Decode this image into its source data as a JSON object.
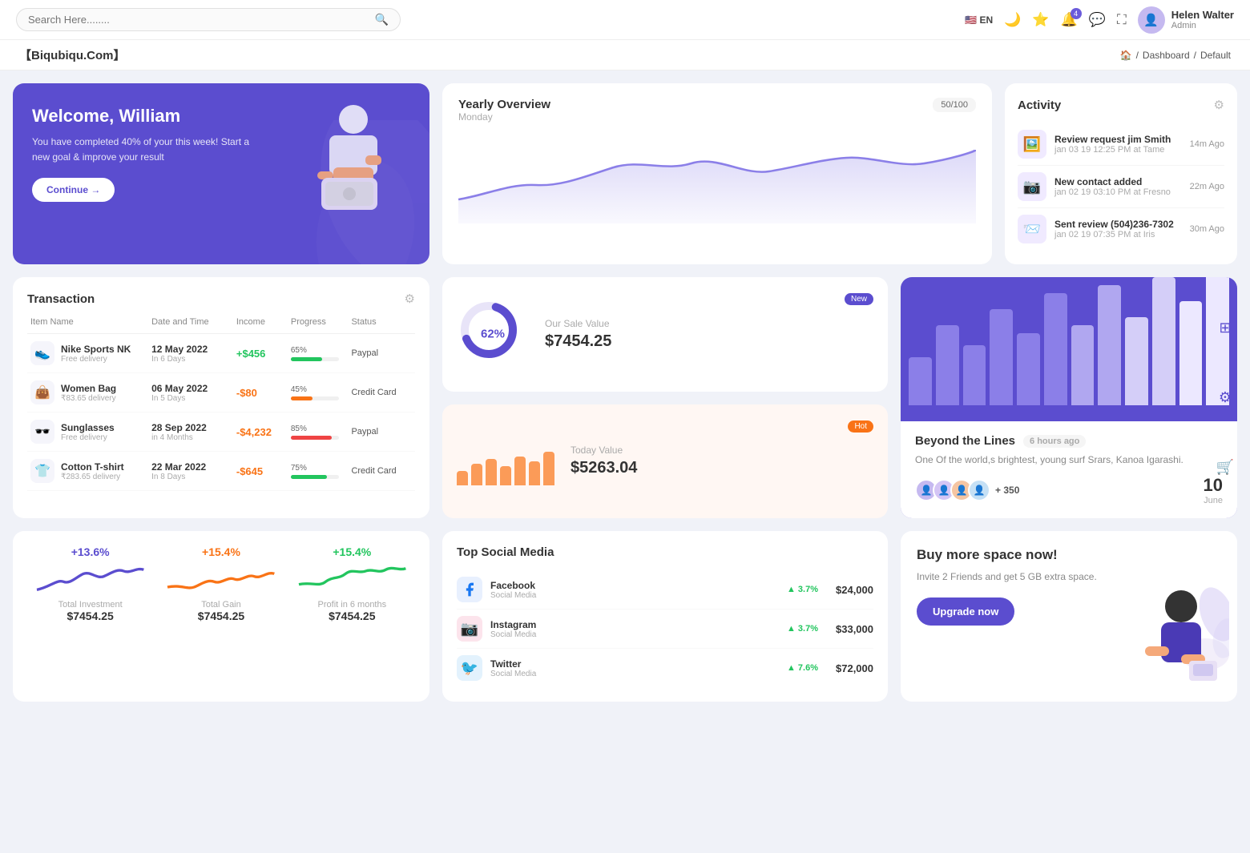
{
  "topnav": {
    "search_placeholder": "Search Here........",
    "lang": "EN",
    "notification_count": "4",
    "user_name": "Helen Walter",
    "user_role": "Admin"
  },
  "breadcrumb": {
    "brand": "【Biqubiqu.Com】",
    "home": "⌂",
    "path1": "Dashboard",
    "path2": "Default"
  },
  "welcome": {
    "title": "Welcome, William",
    "desc": "You have completed 40% of your this week! Start a new goal & improve your result",
    "btn": "Continue →"
  },
  "yearly": {
    "title": "Yearly Overview",
    "day": "Monday",
    "badge": "50/100"
  },
  "activity": {
    "title": "Activity",
    "items": [
      {
        "title": "Review request jim Smith",
        "sub": "jan 03 19 12:25 PM at Tame",
        "time": "14m Ago"
      },
      {
        "title": "New contact added",
        "sub": "jan 02 19 03:10 PM at Fresno",
        "time": "22m Ago"
      },
      {
        "title": "Sent review (504)236-7302",
        "sub": "jan 02 19 07:35 PM at Iris",
        "time": "30m Ago"
      }
    ]
  },
  "transaction": {
    "title": "Transaction",
    "columns": [
      "Item Name",
      "Date and Time",
      "Income",
      "Progress",
      "Status"
    ],
    "rows": [
      {
        "icon": "👟",
        "name": "Nike Sports NK",
        "sub": "Free delivery",
        "date": "12 May 2022",
        "days": "In 6 Days",
        "income": "+$456",
        "income_type": "pos",
        "progress": 65,
        "progress_color": "#22c55e",
        "status": "Paypal"
      },
      {
        "icon": "👜",
        "name": "Women Bag",
        "sub": "₹83.65 delivery",
        "date": "06 May 2022",
        "days": "In 5 Days",
        "income": "-$80",
        "income_type": "neg",
        "progress": 45,
        "progress_color": "#f97316",
        "status": "Credit Card"
      },
      {
        "icon": "🕶️",
        "name": "Sunglasses",
        "sub": "Free delivery",
        "date": "28 Sep 2022",
        "days": "in 4 Months",
        "income": "-$4,232",
        "income_type": "neg",
        "progress": 85,
        "progress_color": "#ef4444",
        "status": "Paypal"
      },
      {
        "icon": "👕",
        "name": "Cotton T-shirt",
        "sub": "₹283.65 delivery",
        "date": "22 Mar 2022",
        "days": "In 8 Days",
        "income": "-$645",
        "income_type": "neg",
        "progress": 75,
        "progress_color": "#22c55e",
        "status": "Credit Card"
      }
    ]
  },
  "sale_new": {
    "badge": "New",
    "donut_pct": "62%",
    "title": "Our Sale Value",
    "value": "$7454.25"
  },
  "sale_hot": {
    "badge": "Hot",
    "title": "Today Value",
    "value": "$5263.04",
    "bars": [
      30,
      45,
      55,
      40,
      60,
      50,
      70
    ]
  },
  "beyond": {
    "title": "Beyond the Lines",
    "time": "6 hours ago",
    "desc": "One Of the world,s brightest, young surf Srars, Kanoa Igarashi.",
    "plus_count": "+ 350",
    "date_num": "10",
    "date_month": "June",
    "bars": [
      60,
      100,
      75,
      120,
      90,
      140,
      100,
      150,
      110,
      160,
      130,
      170
    ],
    "bar_colors": [
      "#8b7fe8",
      "#8b7fe8",
      "#8b7fe8",
      "#8b7fe8",
      "#8b7fe8",
      "#8b7fe8",
      "#b0a7f0",
      "#b0a7f0",
      "#d4cef8",
      "#d4cef8",
      "#ece8ff",
      "#ece8ff"
    ]
  },
  "stats": [
    {
      "pct": "+13.6%",
      "label": "Total Investment",
      "value": "$7454.25",
      "color": "#5b4dcf"
    },
    {
      "pct": "+15.4%",
      "label": "Total Gain",
      "value": "$7454.25",
      "color": "#f97316"
    },
    {
      "pct": "+15.4%",
      "label": "Profit in 6 months",
      "value": "$7454.25",
      "color": "#22c55e"
    }
  ],
  "social": {
    "title": "Top Social Media",
    "items": [
      {
        "name": "Facebook",
        "sub": "Social Media",
        "pct": "3.7%",
        "value": "$24,000",
        "icon": "f",
        "color": "#1877f2"
      },
      {
        "name": "Instagram",
        "sub": "Social Media",
        "pct": "3.7%",
        "value": "$33,000",
        "icon": "📷",
        "color": "#e1306c"
      },
      {
        "name": "Twitter",
        "sub": "Social Media",
        "pct": "7.6%",
        "value": "$72,000",
        "icon": "🐦",
        "color": "#1da1f2"
      }
    ]
  },
  "upgrade": {
    "title": "Buy more space now!",
    "desc": "Invite 2 Friends and get 5 GB extra space.",
    "btn": "Upgrade now"
  }
}
